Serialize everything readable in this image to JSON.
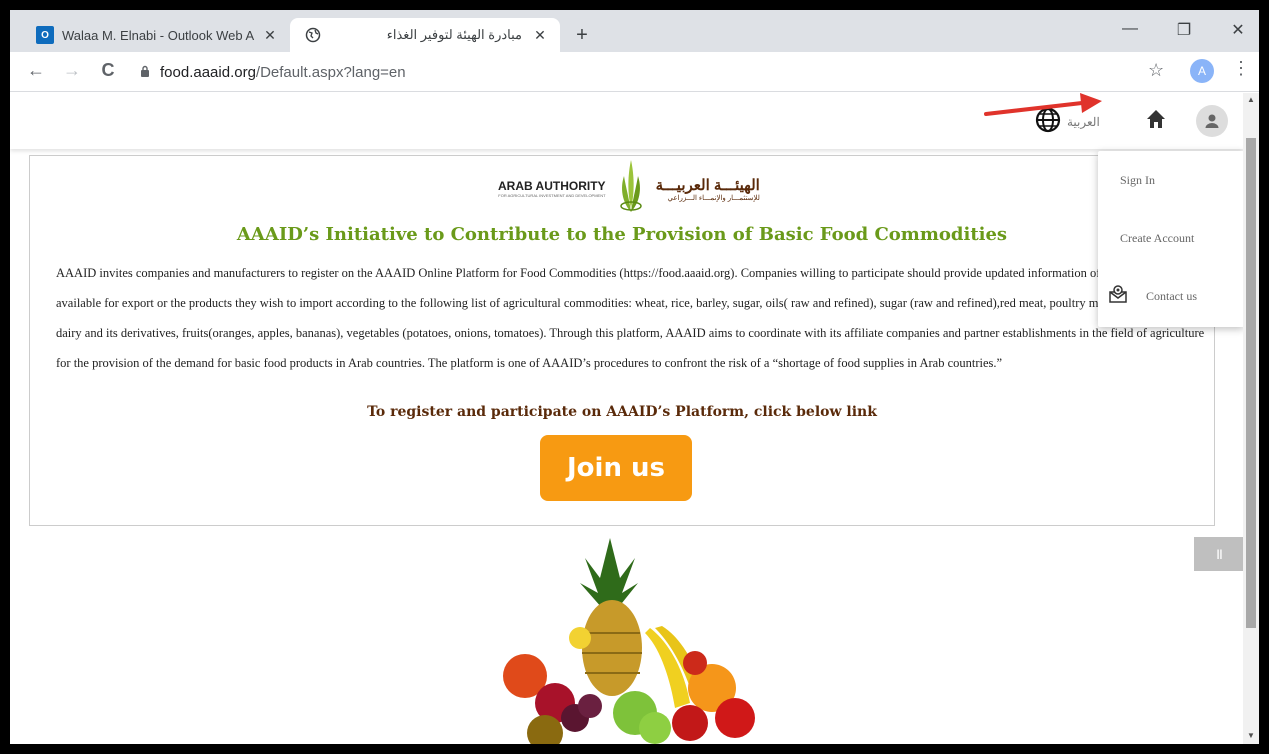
{
  "browser": {
    "tabs": [
      {
        "title": "Walaa M. Elnabi - Outlook Web A",
        "favicon": "outlook-icon",
        "active": false
      },
      {
        "title": "مبادرة الهيئة لتوفير الغذاء",
        "favicon": "globe-icon",
        "active": true
      }
    ],
    "favicon_outlook_label": "O",
    "close_glyph": "✕",
    "new_tab_glyph": "+",
    "window_controls": {
      "minimize": "—",
      "restore": "❐",
      "close": "✕"
    },
    "nav": {
      "back": "←",
      "forward": "→",
      "reload": "C"
    },
    "url_host": "food.aaaid.org",
    "url_path": "/Default.aspx?lang=en",
    "profile_initial": "A",
    "star_glyph": "☆",
    "menu_glyph": "⋮"
  },
  "header": {
    "language_label": "العربية",
    "icons": [
      "globe-icon",
      "home-icon",
      "user-icon"
    ]
  },
  "logo": {
    "en_name": "ARAB AUTHORITY",
    "en_sub": "FOR AGRICULTURAL INVESTMENT AND DEVELOPMENT",
    "ar_name": "الهيئـــة العربيـــة",
    "ar_sub": "للإستثمـــار والإنمـــاء الـــزراعي"
  },
  "main": {
    "heading": "AAAID’s Initiative to Contribute to the Provision of Basic Food Commodities",
    "body": "AAAID invites companies and manufacturers to register on the AAAID Online Platform for Food Commodities (https://food.aaaid.org). Companies willing to participate should provide updated information of the food products available for export or the products they wish to import according to the following list of agricultural commodities: wheat, rice, barley, sugar, oils( raw and refined), sugar (raw and refined),red meat, poultry meat, fish, table eggs, dairy and its derivatives, fruits(oranges, apples, bananas), vegetables (potatoes, onions, tomatoes). Through this platform, AAAID aims to coordinate with its affiliate companies and partner establishments in the field of agriculture for the provision of the demand for basic food products in Arab countries. The platform is one of AAAID’s procedures to confront the risk of a “shortage of food supplies in Arab countries.”",
    "cta_text": "To register and participate on AAAID’s Platform, click below link",
    "join_label": "Join us"
  },
  "slider": {
    "pause_label": "II"
  },
  "dropdown": {
    "sign_in": "Sign In",
    "create_account": "Create Account",
    "contact_us": "Contact us"
  },
  "colors": {
    "heading": "#6a9a1a",
    "cta_text": "#5a2a0a",
    "join_button": "#f79a12",
    "arrow": "#e0332b"
  }
}
